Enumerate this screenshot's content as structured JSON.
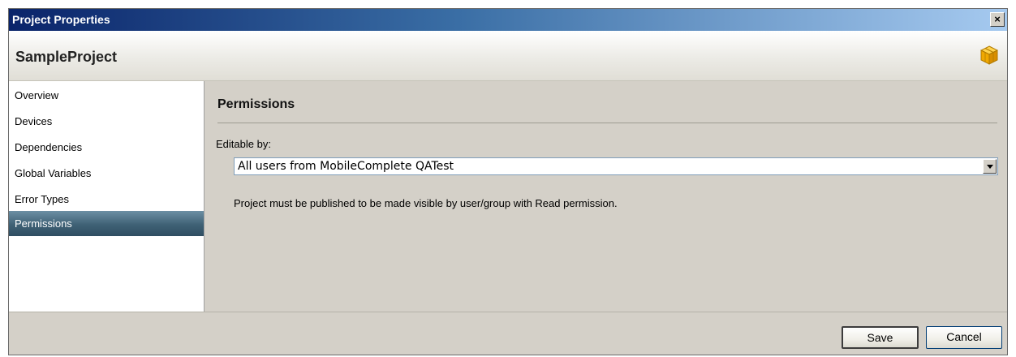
{
  "window": {
    "title": "Project Properties",
    "close_label": "×"
  },
  "project": {
    "name": "SampleProject",
    "icon": "package-box-icon"
  },
  "sidebar": {
    "items": [
      {
        "label": "Overview",
        "active": false
      },
      {
        "label": "Devices",
        "active": false
      },
      {
        "label": "Dependencies",
        "active": false
      },
      {
        "label": "Global Variables",
        "active": false
      },
      {
        "label": "Error Types",
        "active": false
      },
      {
        "label": "Permissions",
        "active": true
      }
    ]
  },
  "main": {
    "section_title": "Permissions",
    "editable_label": "Editable by:",
    "editable_value": "All users from MobileComplete QATest",
    "note": "Project must be published to be made visible by user/group with Read permission."
  },
  "footer": {
    "save_label": "Save",
    "cancel_label": "Cancel"
  },
  "colors": {
    "active_nav": "#3f6175",
    "title_bar_start": "#0a246a",
    "title_bar_end": "#a6caf0"
  }
}
